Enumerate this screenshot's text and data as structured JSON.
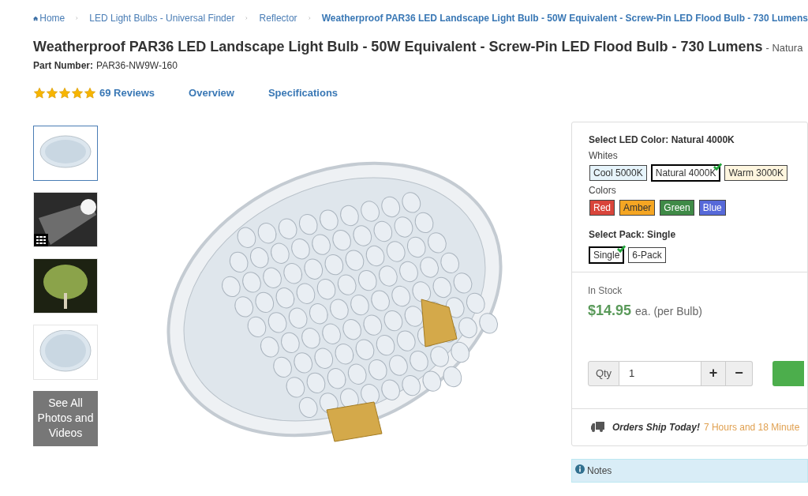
{
  "breadcrumb": [
    {
      "label": "Home",
      "kind": "home"
    },
    {
      "label": "LED Light Bulbs - Universal Finder",
      "kind": "link"
    },
    {
      "label": "Reflector",
      "kind": "link"
    },
    {
      "label": "Weatherproof PAR36 LED Landscape Light Bulb - 50W Equivalent - Screw-Pin LED Flood Bulb - 730 Lumens",
      "kind": "current"
    }
  ],
  "product": {
    "title": "Weatherproof PAR36 LED Landscape Light Bulb - 50W Equivalent - Screw-Pin LED Flood Bulb - 730 Lumens",
    "subtitle": "- Natura",
    "part_label": "Part Number:",
    "part_number": "PAR36-NW9W-160"
  },
  "rating": {
    "stars": 5,
    "reviews": "69 Reviews"
  },
  "nav_links": [
    "Overview",
    "Specifications"
  ],
  "thumbnails": [
    {
      "kind": "photo",
      "selected": true
    },
    {
      "kind": "photo-gallery",
      "selected": false
    },
    {
      "kind": "photo",
      "selected": false
    },
    {
      "kind": "photo",
      "selected": false
    },
    {
      "kind": "see-all",
      "label": "See All Photos and Videos",
      "selected": false
    }
  ],
  "options": {
    "color_heading": "Select LED Color: Natural 4000K",
    "groups": [
      {
        "label": "Whites",
        "swatches": [
          {
            "label": "Cool 5000K",
            "color": "#e6f4fb",
            "selected": false
          },
          {
            "label": "Natural 4000K",
            "color": "#ffffff",
            "selected": true
          },
          {
            "label": "Warm 3000K",
            "color": "#fff6df",
            "selected": false
          }
        ]
      },
      {
        "label": "Colors",
        "swatches": [
          {
            "label": "Red",
            "color": "#d9453b",
            "selected": false
          },
          {
            "label": "Amber",
            "color": "#f5a623",
            "selected": false
          },
          {
            "label": "Green",
            "color": "#3f8a47",
            "selected": false
          },
          {
            "label": "Blue",
            "color": "#5669d9",
            "selected": false
          }
        ]
      }
    ],
    "pack_heading": "Select Pack: Single",
    "packs": [
      {
        "label": "Single",
        "selected": true
      },
      {
        "label": "6-Pack",
        "selected": false
      }
    ]
  },
  "purchase": {
    "stock": "In Stock",
    "price": "$14.95",
    "unit": "ea. (per Bulb)",
    "qty_label": "Qty",
    "qty_value": "1",
    "plus": "+",
    "minus": "−"
  },
  "shipping": {
    "headline": "Orders Ship Today!",
    "countdown": "7 Hours and 18 Minute"
  },
  "notes": {
    "label": "Notes"
  }
}
